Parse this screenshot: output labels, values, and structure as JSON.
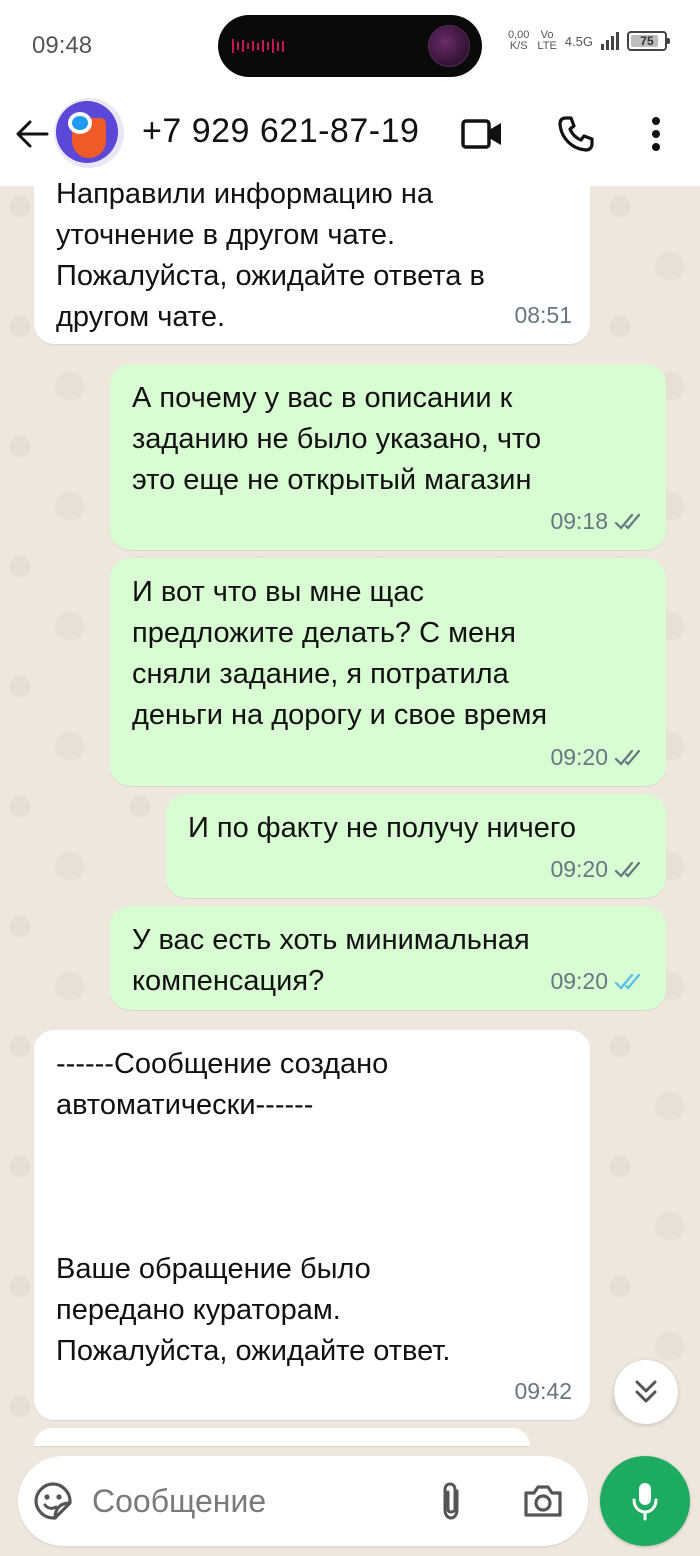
{
  "status_bar": {
    "time": "09:48",
    "net_speed_value": "0,00",
    "net_speed_unit": "K/S",
    "volte_top": "Vo",
    "volte_bottom": "LTE",
    "network": "4.5G",
    "battery": "75"
  },
  "header": {
    "contact": "+7 929 621-87-19",
    "icons": [
      "back-arrow-icon",
      "video-call-icon",
      "phone-icon",
      "more-vert-icon"
    ]
  },
  "messages": [
    {
      "dir": "in",
      "text": "Направили информацию на\nуточнение в другом чате.\nПожалуйста, ожидайте ответа в\nдругом чате.",
      "time": "08:51"
    },
    {
      "dir": "out",
      "text": "А почему у вас в описании к\nзаданию не было указано, что\nэто еще не открытый магазин",
      "time": "09:18",
      "status": "delivered"
    },
    {
      "dir": "out",
      "text": "И вот что вы мне щас\nпредложите делать? С меня\nсняли задание, я потратила\nденьги на дорогу и свое время",
      "time": "09:20",
      "status": "delivered"
    },
    {
      "dir": "out",
      "text": "И по факту не получу ничего",
      "time": "09:20",
      "status": "delivered"
    },
    {
      "dir": "out",
      "text": "У вас есть хоть минимальная\nкомпенсация?",
      "time": "09:20",
      "status": "read"
    },
    {
      "dir": "in",
      "text": "------Сообщение создано\nавтоматически------\n\n\n\nВаше обращение было\nпередано кураторам.\nПожалуйста, ожидайте ответ.",
      "time": "09:42"
    }
  ],
  "composer": {
    "placeholder": "Сообщение"
  },
  "colors": {
    "outgoing_bubble": "#d9fdd3",
    "incoming_bubble": "#ffffff",
    "read_ticks": "#53bdeb",
    "delivered_ticks": "#667781",
    "mic_button": "#1daa61",
    "wallpaper": "#efe7dd"
  }
}
